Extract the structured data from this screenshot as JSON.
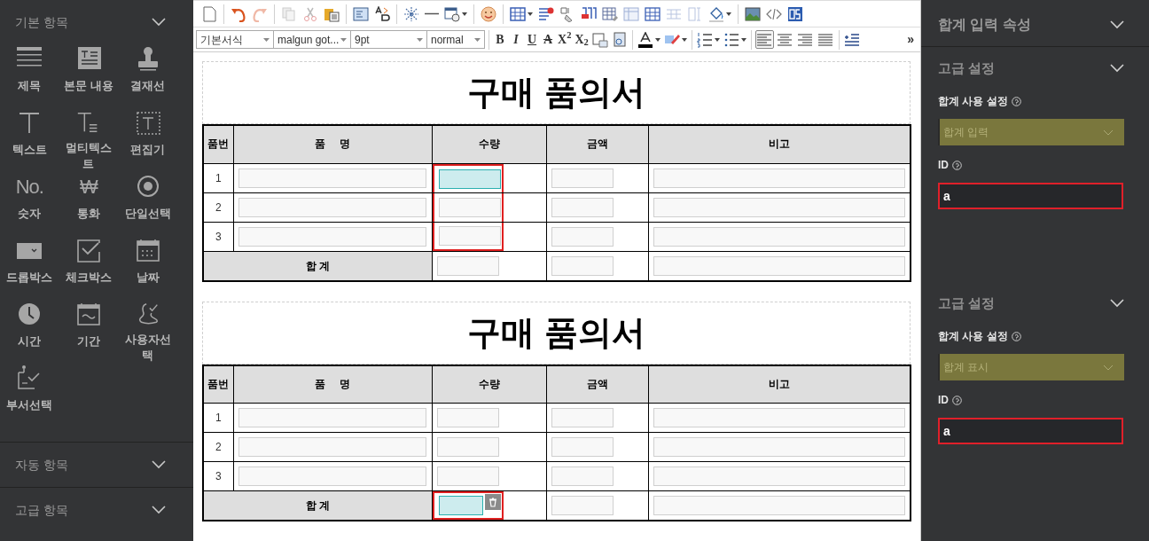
{
  "sidebar": {
    "sections": [
      {
        "title": "기본 항목",
        "expanded": true,
        "items": [
          {
            "label": "제목"
          },
          {
            "label": "본문 내용"
          },
          {
            "label": "결재선"
          },
          {
            "label": "텍스트"
          },
          {
            "label": "멀티텍스트"
          },
          {
            "label": "편집기"
          },
          {
            "label": "숫자",
            "icon_text": "No."
          },
          {
            "label": "통화",
            "icon_text": "₩"
          },
          {
            "label": "단일선택"
          },
          {
            "label": "드롭박스"
          },
          {
            "label": "체크박스"
          },
          {
            "label": "날짜"
          },
          {
            "label": "시간"
          },
          {
            "label": "기간"
          },
          {
            "label": "사용자선택"
          },
          {
            "label": "부서선택"
          }
        ]
      },
      {
        "title": "자동 항목",
        "expanded": false
      },
      {
        "title": "고급 항목",
        "expanded": false
      }
    ]
  },
  "toolbar": {
    "selects": [
      "기본서식",
      "malgun got...",
      "9pt",
      "normal"
    ],
    "format_buttons": [
      {
        "label": "B",
        "kind": "bold"
      },
      {
        "label": "I",
        "kind": "italic"
      },
      {
        "label": "U",
        "kind": "underline"
      },
      {
        "label": "A",
        "kind": "strike"
      },
      {
        "label": "X$^{2}$",
        "kind": "plain"
      },
      {
        "label": "X$_{2}$",
        "kind": "plain"
      }
    ],
    "more": "»",
    "align_buttons": [
      {
        "selected": true
      },
      {
        "selected": false
      },
      {
        "selected": false
      },
      {
        "selected": false
      }
    ]
  },
  "forms": [
    {
      "title": "구매 품의서",
      "columns": [
        "품번",
        "품     명",
        "수량",
        "금액",
        "비고"
      ],
      "rows": [
        {
          "number": "1",
          "quantity_selected": true
        },
        {
          "number": "2",
          "quantity_selected": false
        },
        {
          "number": "3",
          "quantity_selected": false
        }
      ],
      "quantity_column_outlined": true,
      "total": {
        "label": "합 계",
        "quantity_selected": false
      }
    },
    {
      "title": "구매 품의서",
      "columns": [
        "품번",
        "품     명",
        "수량",
        "금액",
        "비고"
      ],
      "rows": [
        {
          "number": "1",
          "quantity_selected": false
        },
        {
          "number": "2",
          "quantity_selected": false
        },
        {
          "number": "3",
          "quantity_selected": false
        }
      ],
      "quantity_column_outlined": false,
      "total": {
        "label": "합 계",
        "quantity_selected": true
      }
    }
  ],
  "properties": {
    "title": "합계 입력 속성",
    "sections": [
      {
        "title": "고급 설정",
        "setting_label": "합계 사용 설정",
        "select_value": "합계 입력",
        "id_label": "ID",
        "id_value": "a",
        "id_invalid": true
      },
      {
        "title": "고급 설정",
        "setting_label": "합계 사용 설정",
        "select_value": "합계 표시",
        "id_label": "ID",
        "id_value": "a",
        "id_invalid": true
      }
    ]
  }
}
